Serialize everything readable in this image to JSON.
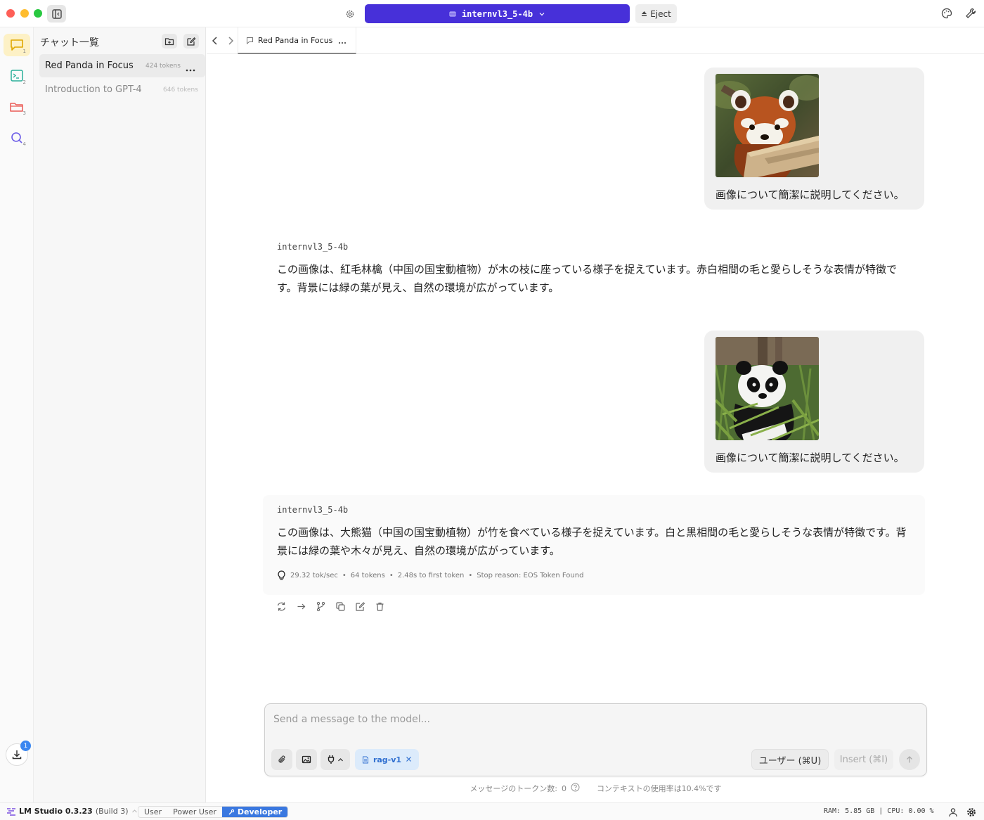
{
  "titlebar": {
    "model_name": "internvl3_5-4b",
    "eject_label": "Eject"
  },
  "activity": {
    "items": [
      {
        "icon": "chat-icon",
        "badge": "1"
      },
      {
        "icon": "terminal-icon",
        "badge": "2"
      },
      {
        "icon": "folder-icon",
        "badge": "3"
      },
      {
        "icon": "search-icon",
        "badge": "4"
      }
    ],
    "download_badge": "1"
  },
  "chatlist": {
    "title": "チャット一覧",
    "items": [
      {
        "title": "Red Panda in Focus",
        "tokens": "424 tokens"
      },
      {
        "title": "Introduction to GPT-4",
        "tokens": "646 tokens"
      }
    ]
  },
  "tab": {
    "title": "Red Panda in Focus"
  },
  "messages": {
    "user": [
      {
        "text": "画像について簡潔に説明してください。",
        "image": "red-panda-photo"
      },
      {
        "text": "画像について簡潔に説明してください。",
        "image": "giant-panda-photo"
      }
    ],
    "assistant": [
      {
        "model": "internvl3_5-4b",
        "text": "この画像は、紅毛林檎（中国の国宝動植物）が木の枝に座っている様子を捉えています。赤白相間の毛と愛らしそうな表情が特徴です。背景には緑の葉が見え、自然の環境が広がっています。"
      },
      {
        "model": "internvl3_5-4b",
        "text": "この画像は、大熊猫（中国の国宝動植物）が竹を食べている様子を捉えています。白と黒相間の毛と愛らしそうな表情が特徴です。背景には緑の葉や木々が見え、自然の環境が広がっています。"
      }
    ],
    "stats": {
      "speed": "29.32 tok/sec",
      "tokens": "64 tokens",
      "first_token": "2.48s to first token",
      "stop": "Stop reason: EOS Token Found"
    }
  },
  "composer": {
    "placeholder": "Send a message to the model...",
    "value": "",
    "rag_label": "rag-v1",
    "role_label": "ユーザー (⌘U)",
    "insert_label": "Insert (⌘I)",
    "token_count_label": "メッセージのトークン数:",
    "token_count": "0",
    "context_usage": "コンテキストの使用率は10.4%です"
  },
  "statusbar": {
    "app_name": "LM Studio 0.3.23",
    "build": "(Build 3)",
    "modes": [
      "User",
      "Power User",
      "Developer"
    ],
    "active_mode": "Developer",
    "sysinfo": "RAM: 5.85 GB  |  CPU: 0.00 %"
  },
  "colors": {
    "accent": "#4730d9",
    "developer_mode": "#3a78e0",
    "rag_chip": "#dcebfb"
  }
}
